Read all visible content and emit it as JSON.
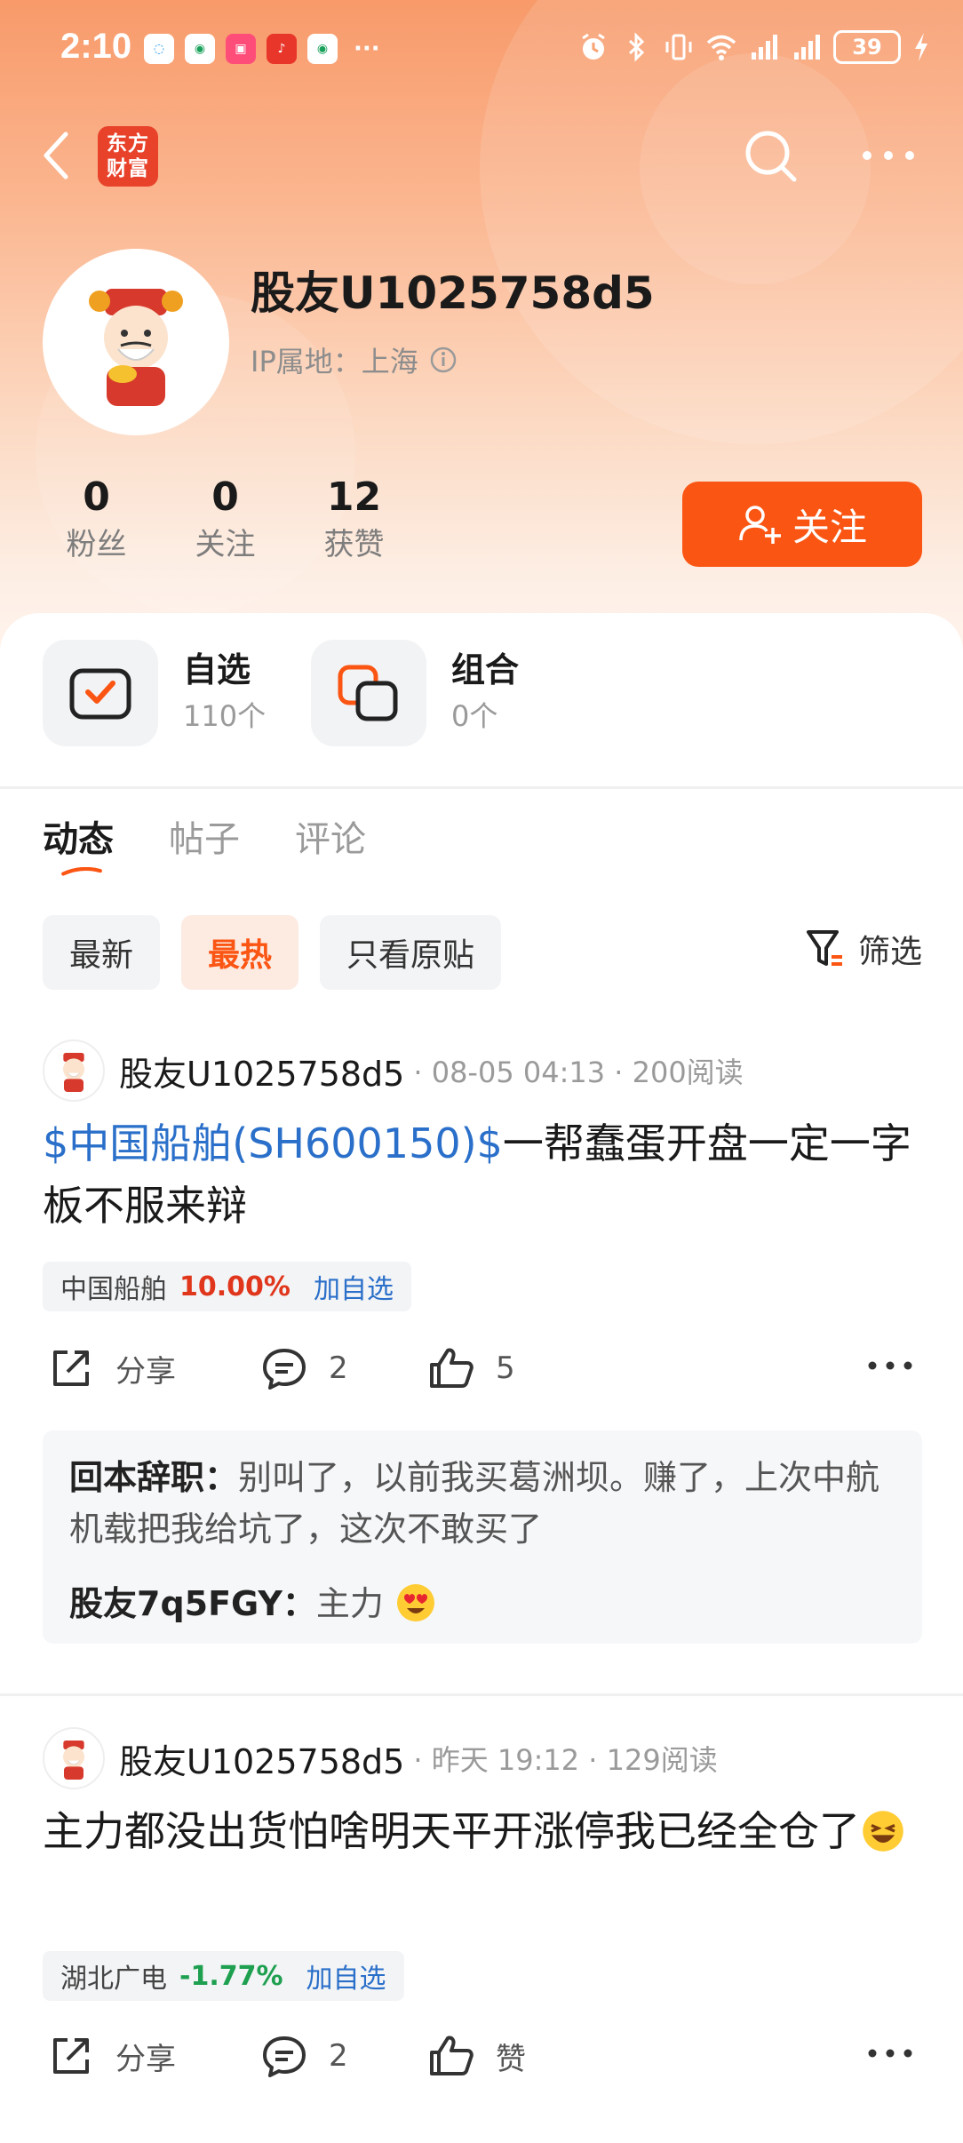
{
  "status_bar": {
    "time": "2:10",
    "notif_more": "···",
    "battery": "39"
  },
  "header": {
    "logo_text_line1": "东方",
    "logo_text_line2": "财富"
  },
  "profile": {
    "username": "股友U1025758d5",
    "ip_label": "IP属地：上海",
    "stats": [
      {
        "value": "0",
        "label": "粉丝"
      },
      {
        "value": "0",
        "label": "关注"
      },
      {
        "value": "12",
        "label": "获赞"
      }
    ],
    "follow_label": "关注"
  },
  "quick": [
    {
      "title": "自选",
      "sub": "110个"
    },
    {
      "title": "组合",
      "sub": "0个"
    }
  ],
  "tabs": [
    "动态",
    "帖子",
    "评论"
  ],
  "filters": [
    "最新",
    "最热",
    "只看原贴"
  ],
  "filter_btn": "筛选",
  "posts": [
    {
      "author": "股友U1025758d5",
      "meta": "· 08-05 04:13 · 200阅读",
      "stock_link": "$中国船舶(SH600150)$",
      "text": "一帮蠢蛋开盘一定一字板不服来辩",
      "tag_name": "中国船舶",
      "tag_change": "10.00%",
      "tag_add": "加自选",
      "share": "分享",
      "comments": "2",
      "likes": "5",
      "replies": [
        {
          "author": "回本辞职：",
          "text": "别叫了，以前我买葛洲坝。赚了，上次中航机载把我给坑了，这次不敢买了"
        },
        {
          "author": "股友7q5FGY：",
          "text": "主力"
        }
      ]
    },
    {
      "author": "股友U1025758d5",
      "meta": "· 昨天 19:12 · 129阅读",
      "text": "主力都没出货怕啥明天平开涨停我已经全仓了",
      "tag_name": "湖北广电",
      "tag_change": "-1.77%",
      "tag_add": "加自选",
      "share": "分享",
      "comments": "2",
      "likes": "赞"
    }
  ],
  "colors": {
    "accent": "#fb5513",
    "link": "#2a6fc9",
    "up": "#e0361c",
    "down": "#1ea050"
  }
}
